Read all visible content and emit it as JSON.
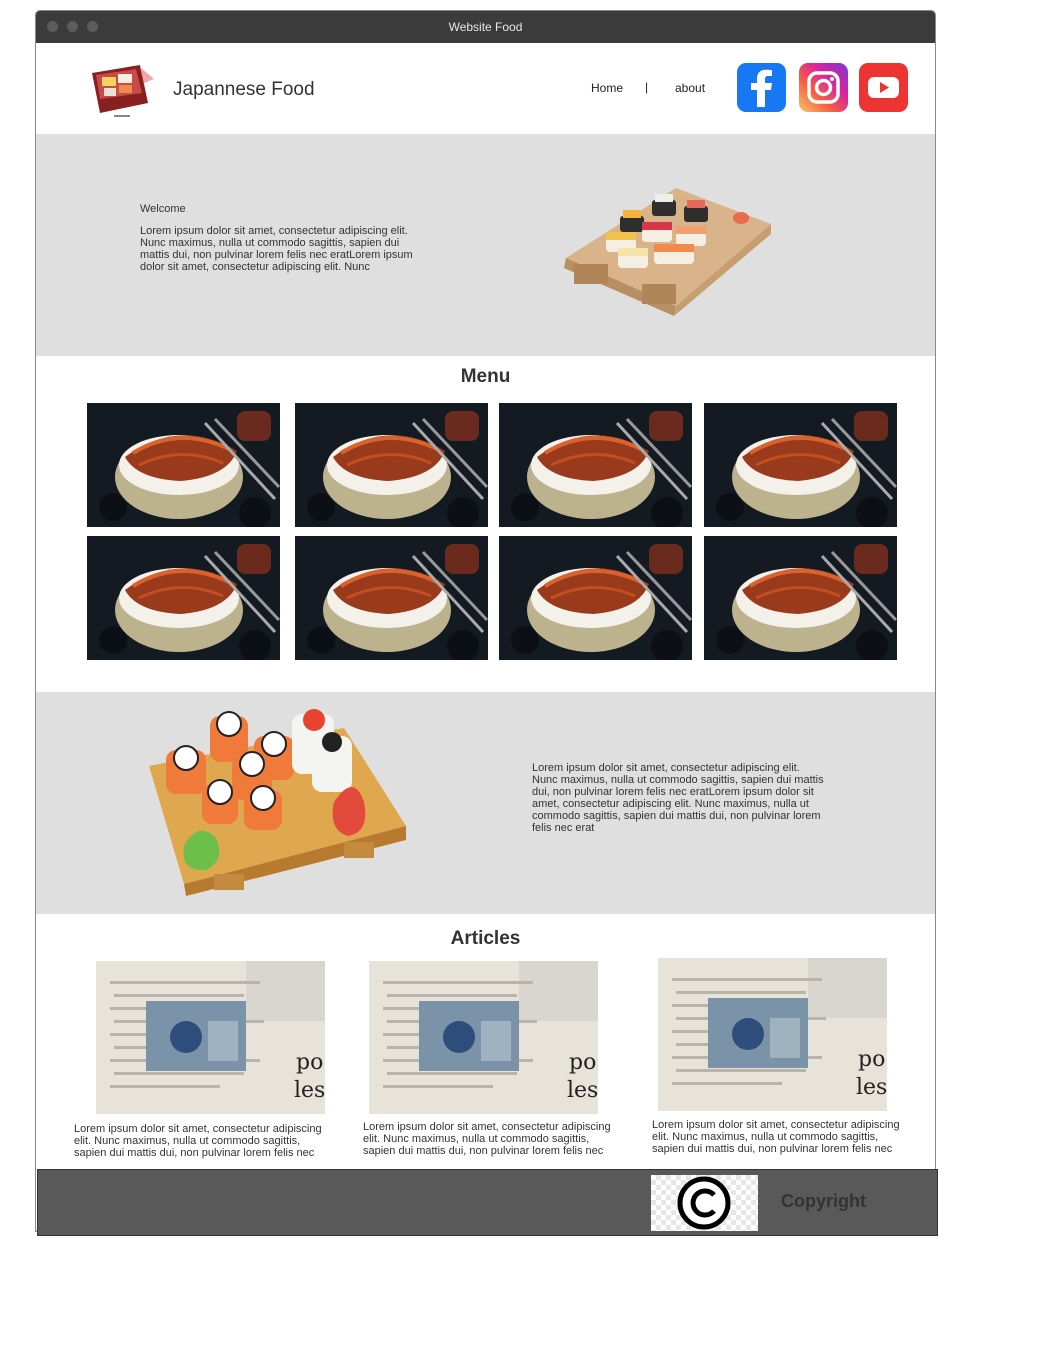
{
  "window": {
    "title": "Website Food"
  },
  "header": {
    "brand": "Japannese Food",
    "nav": {
      "home": "Home",
      "separator": "|",
      "about": "about"
    },
    "social_icons": [
      "facebook-icon",
      "instagram-icon",
      "youtube-icon"
    ]
  },
  "hero": {
    "welcome": "Welcome",
    "text": "Lorem ipsum dolor sit amet, consectetur adipiscing elit. Nunc maximus, nulla ut commodo sagittis, sapien dui mattis dui, non pulvinar lorem felis nec eratLorem ipsum dolor sit amet, consectetur adipiscing elit. Nunc"
  },
  "menu": {
    "title": "Menu",
    "item_count": 8
  },
  "promo": {
    "text": "Lorem ipsum dolor sit amet, consectetur adipiscing elit. Nunc maximus, nulla ut commodo sagittis, sapien dui mattis dui, non pulvinar lorem felis nec eratLorem ipsum dolor sit amet, consectetur adipiscing elit. Nunc maximus, nulla ut commodo sagittis, sapien dui mattis dui, non pulvinar lorem felis nec erat"
  },
  "articles": {
    "title": "Articles",
    "items": [
      {
        "text": "Lorem ipsum dolor sit amet, consectetur adipiscing elit. Nunc maximus, nulla ut commodo sagittis, sapien dui mattis dui, non pulvinar lorem felis nec"
      },
      {
        "text": "Lorem ipsum dolor sit amet, consectetur adipiscing elit. Nunc maximus, nulla ut commodo sagittis, sapien dui mattis dui, non pulvinar lorem felis nec"
      },
      {
        "text": "Lorem ipsum dolor sit amet, consectetur adipiscing elit. Nunc maximus, nulla ut commodo sagittis, sapien dui mattis dui, non pulvinar lorem felis nec"
      }
    ]
  },
  "footer": {
    "copyright": "Copyright",
    "icon": "copyright-icon"
  },
  "colors": {
    "titlebar": "#3b3b3b",
    "section_band": "#dfdfdf",
    "footer": "#595959",
    "facebook": "#1877f2",
    "youtube": "#ee3333"
  }
}
